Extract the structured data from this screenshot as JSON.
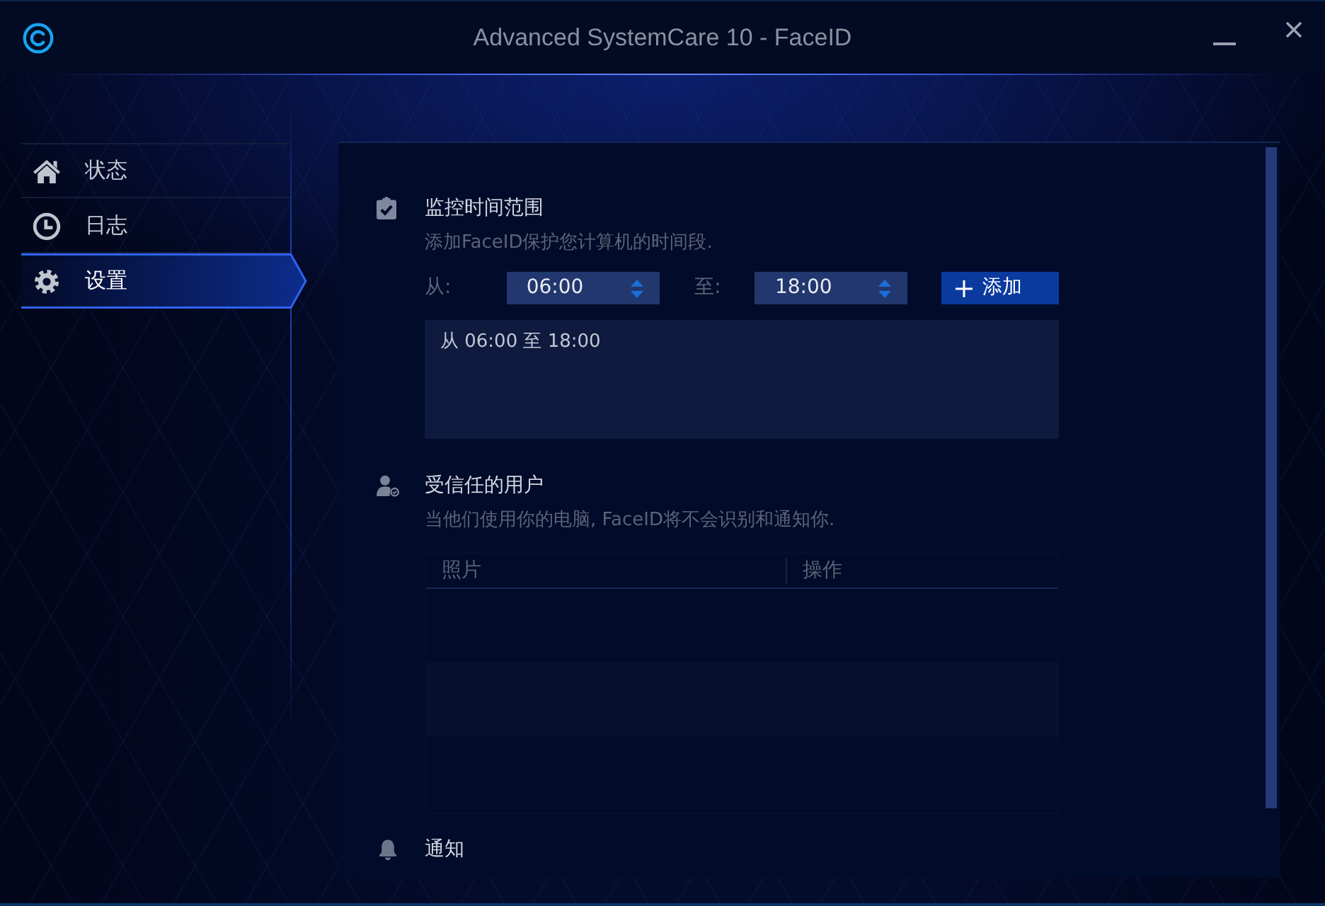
{
  "window": {
    "title": "Advanced SystemCare 10 - FaceID"
  },
  "sidebar": {
    "items": [
      {
        "kind": "status",
        "label": "状态",
        "selected": false
      },
      {
        "kind": "log",
        "label": "日志",
        "selected": false
      },
      {
        "kind": "settings",
        "label": "设置",
        "selected": true
      }
    ]
  },
  "sections": [
    {
      "kind": "time_range",
      "title": "监控时间范围",
      "description": "添加FaceID保护您计算机的时间段.",
      "from_label": "从:",
      "from_value": "06:00",
      "to_label": "至:",
      "to_value": "18:00",
      "add_button": "添加",
      "ranges": [
        "从 06:00 至 18:00"
      ]
    },
    {
      "kind": "trusted_users",
      "title": "受信任的用户",
      "description": "当他们使用你的电脑, FaceID将不会识别和通知你.",
      "table": {
        "columns": [
          "照片",
          "操作"
        ]
      }
    },
    {
      "kind": "notifications",
      "title": "通知"
    }
  ]
}
